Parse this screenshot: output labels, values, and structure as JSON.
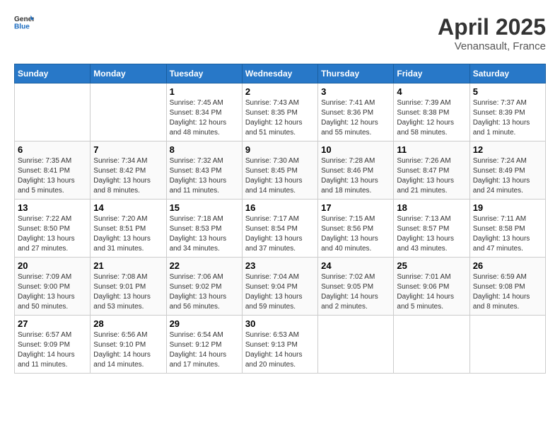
{
  "header": {
    "logo_general": "General",
    "logo_blue": "Blue",
    "month_title": "April 2025",
    "location": "Venansault, France"
  },
  "weekdays": [
    "Sunday",
    "Monday",
    "Tuesday",
    "Wednesday",
    "Thursday",
    "Friday",
    "Saturday"
  ],
  "weeks": [
    [
      {
        "day": null
      },
      {
        "day": null
      },
      {
        "day": "1",
        "sunrise": "Sunrise: 7:45 AM",
        "sunset": "Sunset: 8:34 PM",
        "daylight": "Daylight: 12 hours and 48 minutes."
      },
      {
        "day": "2",
        "sunrise": "Sunrise: 7:43 AM",
        "sunset": "Sunset: 8:35 PM",
        "daylight": "Daylight: 12 hours and 51 minutes."
      },
      {
        "day": "3",
        "sunrise": "Sunrise: 7:41 AM",
        "sunset": "Sunset: 8:36 PM",
        "daylight": "Daylight: 12 hours and 55 minutes."
      },
      {
        "day": "4",
        "sunrise": "Sunrise: 7:39 AM",
        "sunset": "Sunset: 8:38 PM",
        "daylight": "Daylight: 12 hours and 58 minutes."
      },
      {
        "day": "5",
        "sunrise": "Sunrise: 7:37 AM",
        "sunset": "Sunset: 8:39 PM",
        "daylight": "Daylight: 13 hours and 1 minute."
      }
    ],
    [
      {
        "day": "6",
        "sunrise": "Sunrise: 7:35 AM",
        "sunset": "Sunset: 8:41 PM",
        "daylight": "Daylight: 13 hours and 5 minutes."
      },
      {
        "day": "7",
        "sunrise": "Sunrise: 7:34 AM",
        "sunset": "Sunset: 8:42 PM",
        "daylight": "Daylight: 13 hours and 8 minutes."
      },
      {
        "day": "8",
        "sunrise": "Sunrise: 7:32 AM",
        "sunset": "Sunset: 8:43 PM",
        "daylight": "Daylight: 13 hours and 11 minutes."
      },
      {
        "day": "9",
        "sunrise": "Sunrise: 7:30 AM",
        "sunset": "Sunset: 8:45 PM",
        "daylight": "Daylight: 13 hours and 14 minutes."
      },
      {
        "day": "10",
        "sunrise": "Sunrise: 7:28 AM",
        "sunset": "Sunset: 8:46 PM",
        "daylight": "Daylight: 13 hours and 18 minutes."
      },
      {
        "day": "11",
        "sunrise": "Sunrise: 7:26 AM",
        "sunset": "Sunset: 8:47 PM",
        "daylight": "Daylight: 13 hours and 21 minutes."
      },
      {
        "day": "12",
        "sunrise": "Sunrise: 7:24 AM",
        "sunset": "Sunset: 8:49 PM",
        "daylight": "Daylight: 13 hours and 24 minutes."
      }
    ],
    [
      {
        "day": "13",
        "sunrise": "Sunrise: 7:22 AM",
        "sunset": "Sunset: 8:50 PM",
        "daylight": "Daylight: 13 hours and 27 minutes."
      },
      {
        "day": "14",
        "sunrise": "Sunrise: 7:20 AM",
        "sunset": "Sunset: 8:51 PM",
        "daylight": "Daylight: 13 hours and 31 minutes."
      },
      {
        "day": "15",
        "sunrise": "Sunrise: 7:18 AM",
        "sunset": "Sunset: 8:53 PM",
        "daylight": "Daylight: 13 hours and 34 minutes."
      },
      {
        "day": "16",
        "sunrise": "Sunrise: 7:17 AM",
        "sunset": "Sunset: 8:54 PM",
        "daylight": "Daylight: 13 hours and 37 minutes."
      },
      {
        "day": "17",
        "sunrise": "Sunrise: 7:15 AM",
        "sunset": "Sunset: 8:56 PM",
        "daylight": "Daylight: 13 hours and 40 minutes."
      },
      {
        "day": "18",
        "sunrise": "Sunrise: 7:13 AM",
        "sunset": "Sunset: 8:57 PM",
        "daylight": "Daylight: 13 hours and 43 minutes."
      },
      {
        "day": "19",
        "sunrise": "Sunrise: 7:11 AM",
        "sunset": "Sunset: 8:58 PM",
        "daylight": "Daylight: 13 hours and 47 minutes."
      }
    ],
    [
      {
        "day": "20",
        "sunrise": "Sunrise: 7:09 AM",
        "sunset": "Sunset: 9:00 PM",
        "daylight": "Daylight: 13 hours and 50 minutes."
      },
      {
        "day": "21",
        "sunrise": "Sunrise: 7:08 AM",
        "sunset": "Sunset: 9:01 PM",
        "daylight": "Daylight: 13 hours and 53 minutes."
      },
      {
        "day": "22",
        "sunrise": "Sunrise: 7:06 AM",
        "sunset": "Sunset: 9:02 PM",
        "daylight": "Daylight: 13 hours and 56 minutes."
      },
      {
        "day": "23",
        "sunrise": "Sunrise: 7:04 AM",
        "sunset": "Sunset: 9:04 PM",
        "daylight": "Daylight: 13 hours and 59 minutes."
      },
      {
        "day": "24",
        "sunrise": "Sunrise: 7:02 AM",
        "sunset": "Sunset: 9:05 PM",
        "daylight": "Daylight: 14 hours and 2 minutes."
      },
      {
        "day": "25",
        "sunrise": "Sunrise: 7:01 AM",
        "sunset": "Sunset: 9:06 PM",
        "daylight": "Daylight: 14 hours and 5 minutes."
      },
      {
        "day": "26",
        "sunrise": "Sunrise: 6:59 AM",
        "sunset": "Sunset: 9:08 PM",
        "daylight": "Daylight: 14 hours and 8 minutes."
      }
    ],
    [
      {
        "day": "27",
        "sunrise": "Sunrise: 6:57 AM",
        "sunset": "Sunset: 9:09 PM",
        "daylight": "Daylight: 14 hours and 11 minutes."
      },
      {
        "day": "28",
        "sunrise": "Sunrise: 6:56 AM",
        "sunset": "Sunset: 9:10 PM",
        "daylight": "Daylight: 14 hours and 14 minutes."
      },
      {
        "day": "29",
        "sunrise": "Sunrise: 6:54 AM",
        "sunset": "Sunset: 9:12 PM",
        "daylight": "Daylight: 14 hours and 17 minutes."
      },
      {
        "day": "30",
        "sunrise": "Sunrise: 6:53 AM",
        "sunset": "Sunset: 9:13 PM",
        "daylight": "Daylight: 14 hours and 20 minutes."
      },
      {
        "day": null
      },
      {
        "day": null
      },
      {
        "day": null
      }
    ]
  ]
}
